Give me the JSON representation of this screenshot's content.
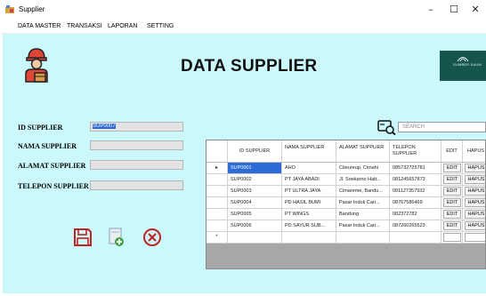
{
  "window": {
    "title": "Supplier",
    "minimize_glyph": "–",
    "maximize_glyph": "☐",
    "close_glyph": "✕"
  },
  "menu": {
    "items": [
      "DATA MASTER",
      "TRANSAKSI",
      "LAPORAN",
      "SETTING"
    ]
  },
  "header": {
    "title": "DATA SUPPLIER",
    "logo_icon": "supplier-worker-icon",
    "brand_logo_text": "SUMBER SAUM"
  },
  "form": {
    "id_label": "ID SUPPLIER",
    "id_value": "SUP0007",
    "name_label": "NAMA SUPPLIER",
    "name_value": "",
    "address_label": "ALAMAT SUPPLIER",
    "address_value": "",
    "phone_label": "TELEPON SUPPLIER",
    "phone_value": ""
  },
  "actions": {
    "save_icon": "floppy-disk-icon",
    "add_icon": "new-document-icon",
    "cancel_icon": "cancel-circle-icon"
  },
  "search": {
    "placeholder": "SEARCH",
    "icon": "search-card-icon"
  },
  "table": {
    "columns": [
      "ID SUPPLIER",
      "NAMA SUPPLIER",
      "ALAMAT SUPPLIER",
      "TELEPON SUPPLIER",
      "EDIT",
      "HAPUS"
    ],
    "current_row_marker": "▸",
    "new_row_marker": "*",
    "rows": [
      {
        "id": "SUP0001",
        "name": "AHO",
        "address": "Citeureup, Cimahi",
        "phone": "085732725781",
        "edit": "EDIT",
        "delete": "HAPUS"
      },
      {
        "id": "SUP0002",
        "name": "PT JAYA ABADI",
        "address": "Jl. Soekarno Hatt...",
        "phone": "081245657873",
        "edit": "EDIT",
        "delete": "HAPUS"
      },
      {
        "id": "SUP0003",
        "name": "PT ULTRA JAYA",
        "address": "Cimareme, Bandu...",
        "phone": "081127357932",
        "edit": "EDIT",
        "delete": "HAPUS"
      },
      {
        "id": "SUP0004",
        "name": "PD HASIL BUMI",
        "address": "Pasar Induk Cari...",
        "phone": "08767586469",
        "edit": "EDIT",
        "delete": "HAPUS"
      },
      {
        "id": "SUP0005",
        "name": "PT WINGS",
        "address": "Bandung",
        "phone": "082372782",
        "edit": "EDIT",
        "delete": "HAPUS"
      },
      {
        "id": "SUP0006",
        "name": "PD SAYUR SUB...",
        "address": "Pasar Induk Cari...",
        "phone": "087260265523",
        "edit": "EDIT",
        "delete": "HAPUS"
      }
    ]
  },
  "colors": {
    "background": "#caf8fb",
    "selection": "#2d6cd6",
    "grid_empty": "#a7a7a7",
    "logo_bg": "#16544e"
  }
}
